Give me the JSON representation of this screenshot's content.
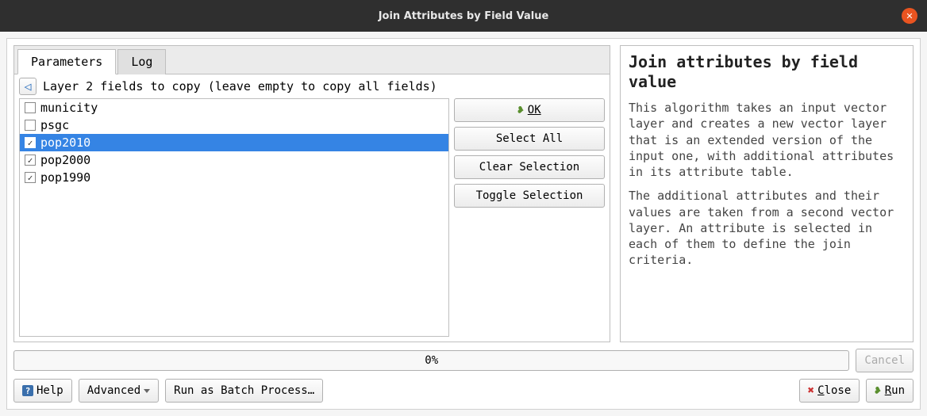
{
  "window": {
    "title": "Join Attributes by Field Value"
  },
  "tabs": {
    "parameters": "Parameters",
    "log": "Log"
  },
  "subheader": {
    "label": "Layer 2 fields to copy (leave empty to copy all fields)"
  },
  "fields": [
    {
      "name": "municity",
      "checked": false,
      "selected": false
    },
    {
      "name": "psgc",
      "checked": false,
      "selected": false
    },
    {
      "name": "pop2010",
      "checked": true,
      "selected": true
    },
    {
      "name": "pop2000",
      "checked": true,
      "selected": false
    },
    {
      "name": "pop1990",
      "checked": true,
      "selected": false
    }
  ],
  "side_buttons": {
    "ok": "OK",
    "select_all": "Select All",
    "clear": "Clear Selection",
    "toggle": "Toggle Selection"
  },
  "help": {
    "title": "Join attributes by field value",
    "p1": "This algorithm takes an input vector layer and creates a new vector layer that is an extended version of the input one, with additional attributes in its attribute table.",
    "p2": "The additional attributes and their values are taken from a second vector layer. An attribute is selected in each of them to define the join criteria."
  },
  "progress": {
    "text": "0%"
  },
  "bottom": {
    "help": "Help",
    "advanced": "Advanced",
    "batch": "Run as Batch Process…",
    "cancel": "Cancel",
    "close": "Close",
    "run": "Run"
  }
}
